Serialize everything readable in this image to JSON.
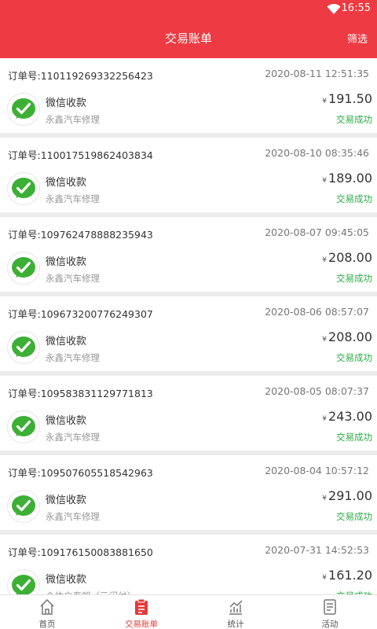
{
  "status_bar": {
    "time": "16:55",
    "icons": [
      "wifi-icon"
    ]
  },
  "header": {
    "title": "交易账单",
    "filter_label": "筛选"
  },
  "transactions": [
    {
      "order_no": "订单号:110119269332256423",
      "time": "2020-08-11 12:51:35",
      "method": "微信收款",
      "merchant": "永鑫汽车修理",
      "currency": "¥",
      "amount": "191.50",
      "status": "交易成功"
    },
    {
      "order_no": "订单号:110017519862403834",
      "time": "2020-08-10 08:35:46",
      "method": "微信收款",
      "merchant": "永鑫汽车修理",
      "currency": "¥",
      "amount": "189.00",
      "status": "交易成功"
    },
    {
      "order_no": "订单号:109762478888235943",
      "time": "2020-08-07 09:45:05",
      "method": "微信收款",
      "merchant": "永鑫汽车修理",
      "currency": "¥",
      "amount": "208.00",
      "status": "交易成功"
    },
    {
      "order_no": "订单号:109673200776249307",
      "time": "2020-08-06 08:57:07",
      "method": "微信收款",
      "merchant": "永鑫汽车修理",
      "currency": "¥",
      "amount": "208.00",
      "status": "交易成功"
    },
    {
      "order_no": "订单号:109583831129771813",
      "time": "2020-08-05 08:07:37",
      "method": "微信收款",
      "merchant": "永鑫汽车修理",
      "currency": "¥",
      "amount": "243.00",
      "status": "交易成功"
    },
    {
      "order_no": "订单号:109507605518542963",
      "time": "2020-08-04 10:57:12",
      "method": "微信收款",
      "merchant": "永鑫汽车修理",
      "currency": "¥",
      "amount": "291.00",
      "status": "交易成功"
    },
    {
      "order_no": "订单号:109176150083881650",
      "time": "2020-07-31 14:52:53",
      "method": "微信收款",
      "merchant": "个体户秦朗（云闪付）",
      "currency": "¥",
      "amount": "161.20",
      "status": "交易成功"
    }
  ],
  "tabs": [
    {
      "label": "首页",
      "icon": "home-icon",
      "active": false
    },
    {
      "label": "交易账单",
      "icon": "bill-icon",
      "active": true
    },
    {
      "label": "统计",
      "icon": "chart-icon",
      "active": false
    },
    {
      "label": "活动",
      "icon": "activity-icon",
      "active": false
    }
  ],
  "colors": {
    "primary": "#ee3a42",
    "success": "#2bae44",
    "wechat": "#3cb035"
  }
}
